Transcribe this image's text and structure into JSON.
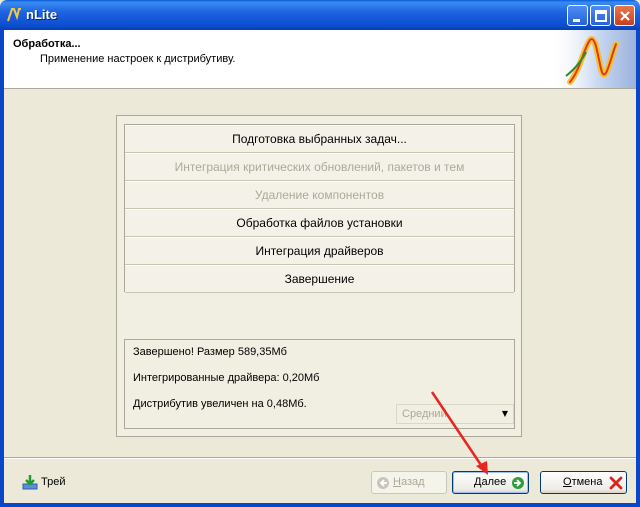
{
  "window": {
    "title": "nLite"
  },
  "header": {
    "title": "Обработка...",
    "subtitle": "Применение настроек к дистрибутиву."
  },
  "tasks": [
    {
      "label": "Подготовка выбранных задач...",
      "enabled": true
    },
    {
      "label": "Интеграция критических обновлений, пакетов и тем",
      "enabled": false
    },
    {
      "label": "Удаление компонентов",
      "enabled": false
    },
    {
      "label": "Обработка файлов установки",
      "enabled": true
    },
    {
      "label": "Интеграция драйверов",
      "enabled": true
    },
    {
      "label": "Завершение",
      "enabled": true
    }
  ],
  "results": {
    "line1": "Завершено! Размер 589,35Мб",
    "line2": "Интегрированные драйвера: 0,20Мб",
    "line3": "Дистрибутив увеличен на 0,48Мб.",
    "priority_value": "Средний"
  },
  "footer": {
    "tray_label": "Трей",
    "back_label_first": "Н",
    "back_label_rest": "азад",
    "next_label_first": "Д",
    "next_label_rest": "алее",
    "cancel_label_first": "О",
    "cancel_label_rest": "тмена"
  },
  "colors": {
    "titlebar": "#0A5FD8",
    "background": "#ECE9D8",
    "annotation_arrow": "#E8261E"
  }
}
